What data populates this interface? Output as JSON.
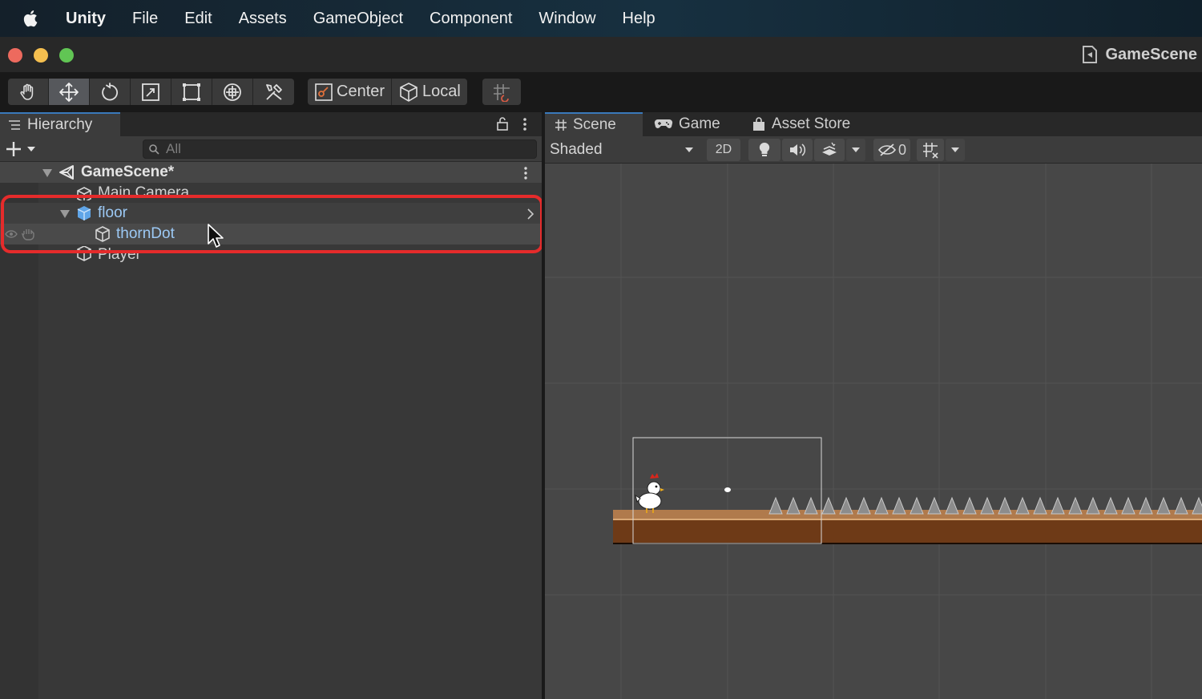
{
  "menubar": {
    "items": [
      "Unity",
      "File",
      "Edit",
      "Assets",
      "GameObject",
      "Component",
      "Window",
      "Help"
    ]
  },
  "window": {
    "scene_name": "GameScene"
  },
  "toolbar": {
    "tools": [
      "hand-tool",
      "move-tool",
      "rotate-tool",
      "scale-tool",
      "rect-tool",
      "transform-tool",
      "custom-tool"
    ],
    "active_tool": "move-tool",
    "pivot_label": "Center",
    "space_label": "Local"
  },
  "hierarchy": {
    "tab_label": "Hierarchy",
    "search_placeholder": "All",
    "scene_label": "GameScene*",
    "items": [
      {
        "label": "Main Camera"
      },
      {
        "label": "floor"
      },
      {
        "label": "thornDot"
      },
      {
        "label": "Player"
      }
    ]
  },
  "scene_view": {
    "tabs": [
      "Scene",
      "Game",
      "Asset Store"
    ],
    "active_tab": "Scene",
    "shading_mode": "Shaded",
    "mode_2d_label": "2D",
    "hidden_count": "0"
  },
  "colors": {
    "highlight": "#e52b2b",
    "selected_text": "#9cc9f5",
    "tab_accent": "#3a79bb"
  }
}
